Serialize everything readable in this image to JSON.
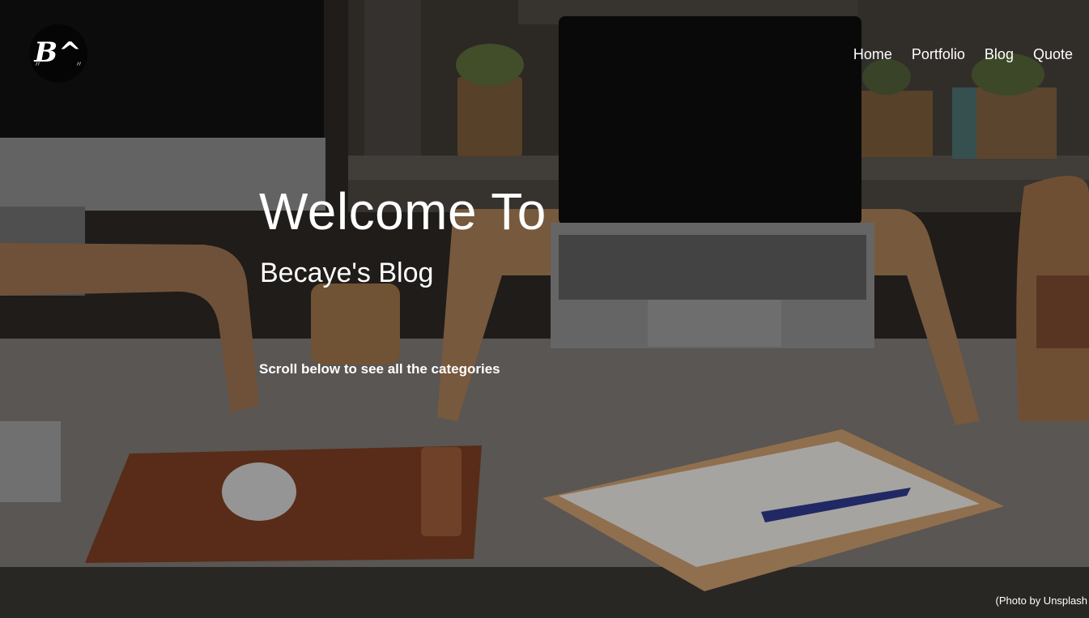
{
  "header": {
    "logo_text": "B^",
    "nav": [
      "Home",
      "Portfolio",
      "Blog",
      "Quote"
    ]
  },
  "hero": {
    "title": "Welcome To",
    "subtitle": "Becaye's Blog",
    "hint": "Scroll below to see all the categories",
    "credit": "(Photo by Unsplash"
  },
  "icons": {
    "logo": "brand-logo-icon"
  },
  "colors": {
    "text": "#ffffff",
    "logo_bg": "#050505"
  }
}
